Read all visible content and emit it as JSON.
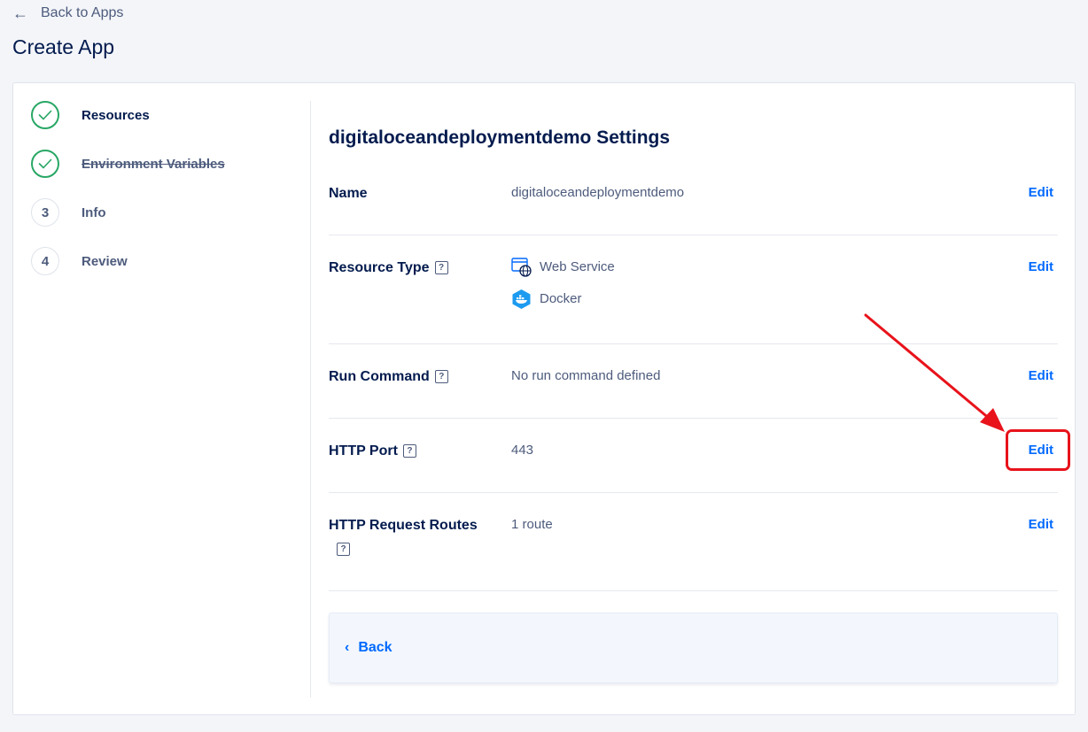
{
  "nav": {
    "back_label": "Back to Apps"
  },
  "page": {
    "title": "Create App"
  },
  "steps": [
    {
      "marker": "",
      "label": "Resources",
      "state": "done-active"
    },
    {
      "marker": "",
      "label": "Environment Variables",
      "state": "done"
    },
    {
      "marker": "3",
      "label": "Info",
      "state": "pending"
    },
    {
      "marker": "4",
      "label": "Review",
      "state": "pending"
    }
  ],
  "settings": {
    "title": "digitaloceandeployment­demo Settings",
    "edit_label": "Edit",
    "name": {
      "label": "Name",
      "value": "digitaloceandeploymentdemo"
    },
    "resource_type": {
      "label": "Resource Type",
      "items": [
        {
          "icon": "web-service-icon",
          "label": "Web Service"
        },
        {
          "icon": "docker-icon",
          "label": "Docker"
        }
      ]
    },
    "run_command": {
      "label": "Run Command",
      "value": "No run command defined"
    },
    "http_port": {
      "label": "HTTP Port",
      "value": "443"
    },
    "http_routes": {
      "label": "HTTP Request Routes",
      "value": "1 route"
    }
  },
  "footer": {
    "back_label": "Back"
  },
  "help_glyph": "?",
  "colors": {
    "accent": "#0069ff",
    "success": "#28a765",
    "annotation": "#e8131b"
  }
}
